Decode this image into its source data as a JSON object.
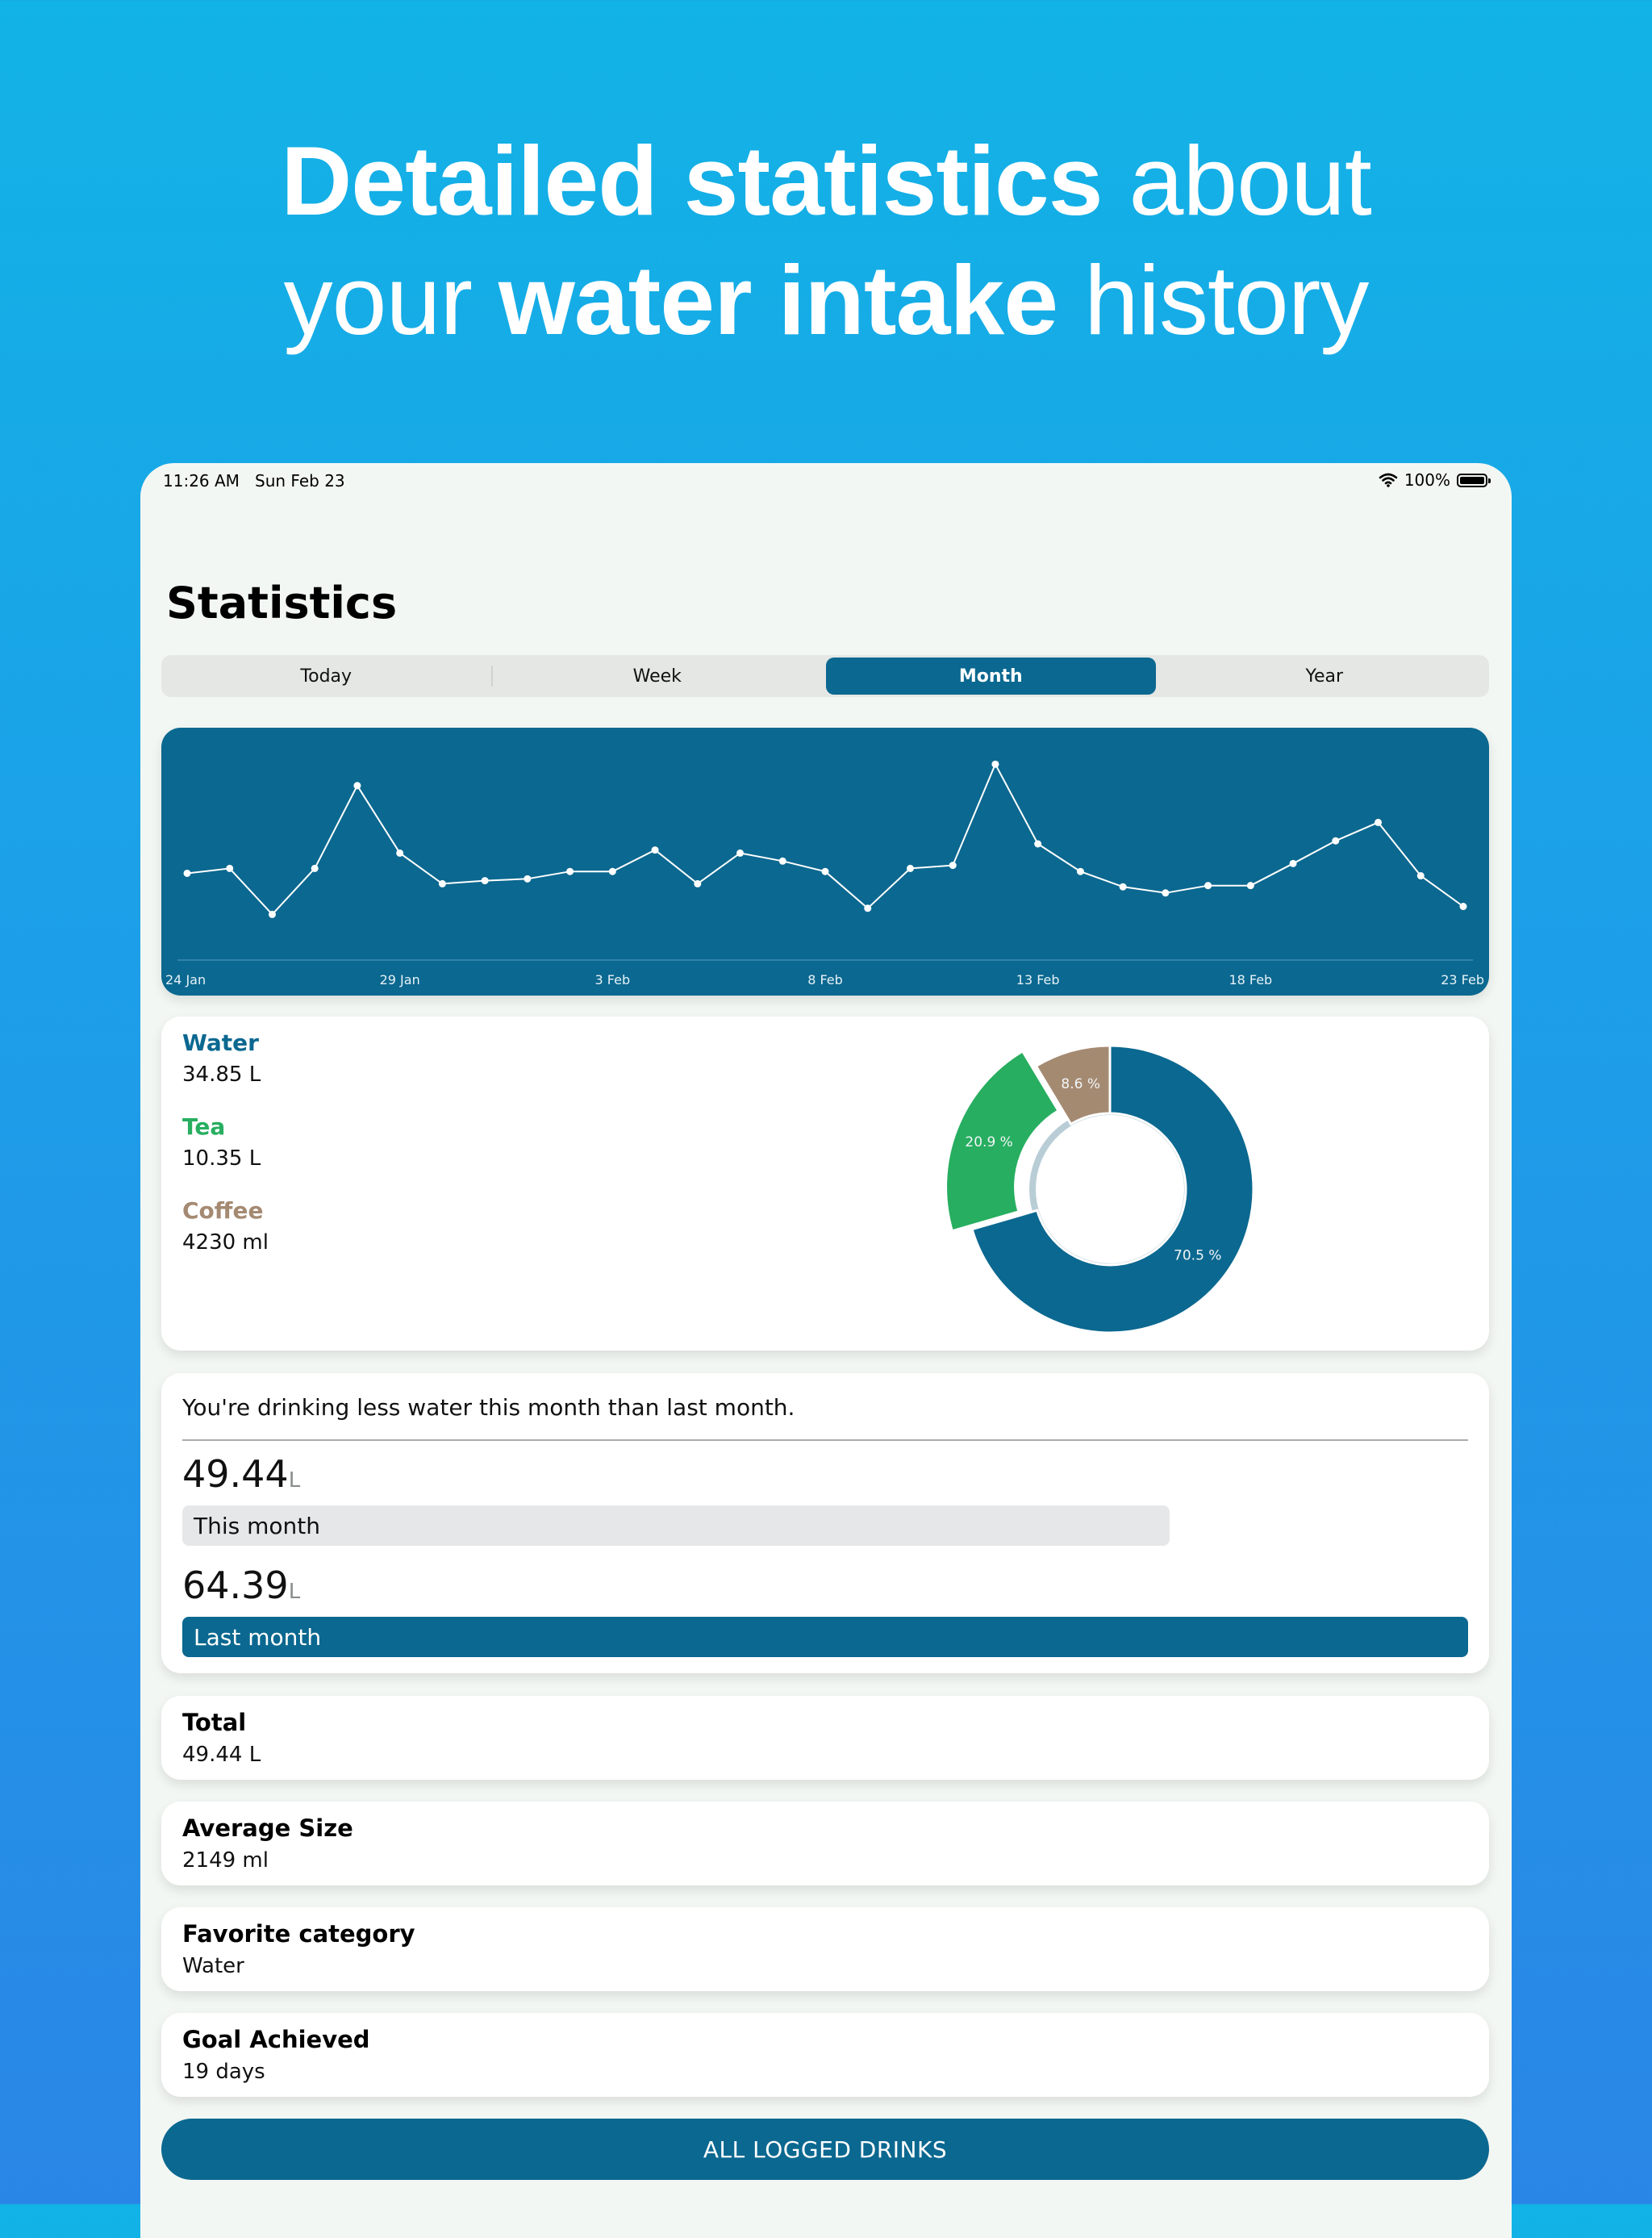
{
  "headline": {
    "line1_bold": "Detailed statistics",
    "line1_light": " about",
    "line2_light1": "your ",
    "line2_bold": "water intake",
    "line2_light2": " history"
  },
  "status_bar": {
    "time": "11:26 AM",
    "date": "Sun Feb 23",
    "battery": "100%",
    "icons": [
      "wifi-icon",
      "battery-icon"
    ]
  },
  "page_title": "Statistics",
  "tabs": [
    {
      "label": "Today",
      "active": false
    },
    {
      "label": "Week",
      "active": false
    },
    {
      "label": "Month",
      "active": true
    },
    {
      "label": "Year",
      "active": false
    }
  ],
  "chart_data": [
    {
      "type": "line",
      "x_tick_labels": [
        "24 Jan",
        "29 Jan",
        "3 Feb",
        "8 Feb",
        "13 Feb",
        "18 Feb",
        "23 Feb"
      ],
      "x": [
        "24 Jan",
        "25 Jan",
        "26 Jan",
        "27 Jan",
        "28 Jan",
        "29 Jan",
        "30 Jan",
        "31 Jan",
        "1 Feb",
        "2 Feb",
        "3 Feb",
        "4 Feb",
        "5 Feb",
        "6 Feb",
        "7 Feb",
        "8 Feb",
        "9 Feb",
        "10 Feb",
        "11 Feb",
        "12 Feb",
        "13 Feb",
        "14 Feb",
        "15 Feb",
        "16 Feb",
        "17 Feb",
        "18 Feb",
        "19 Feb",
        "20 Feb",
        "21 Feb",
        "22 Feb",
        "23 Feb"
      ],
      "values": [
        1.52,
        1.6,
        0.85,
        1.6,
        2.95,
        1.85,
        1.35,
        1.4,
        1.43,
        1.55,
        1.55,
        1.9,
        1.35,
        1.85,
        1.72,
        1.55,
        0.95,
        1.6,
        1.65,
        3.3,
        2.0,
        1.55,
        1.3,
        1.2,
        1.32,
        1.32,
        1.68,
        2.05,
        2.35,
        1.48,
        0.98
      ],
      "ylim": [
        0.5,
        3.5
      ],
      "grid": false,
      "legend": "none",
      "line_color": "#ffffff",
      "background": "#0b6890"
    },
    {
      "type": "pie",
      "variant": "donut",
      "categories": [
        "Water",
        "Tea",
        "Coffee"
      ],
      "values": [
        70.5,
        20.9,
        8.6
      ],
      "labels": [
        "70.5 %",
        "20.9 %",
        "8.6 %"
      ],
      "colors": [
        "#0b6890",
        "#27ae60",
        "#a58a72"
      ],
      "emphasized": "Tea"
    }
  ],
  "breakdown": {
    "items": [
      {
        "name": "Water",
        "amount": "34.85 L",
        "color": "#0b6890"
      },
      {
        "name": "Tea",
        "amount": "10.35 L",
        "color": "#27ae60"
      },
      {
        "name": "Coffee",
        "amount": "4230 ml",
        "color": "#a58a72"
      }
    ]
  },
  "comparison": {
    "message": "You're drinking less water this month than last month.",
    "this_month": {
      "value": "49.44",
      "unit": "L",
      "label": "This month",
      "fraction_of_max": 0.768
    },
    "last_month": {
      "value": "64.39",
      "unit": "L",
      "label": "Last month",
      "fraction_of_max": 1.0
    }
  },
  "stats": [
    {
      "label": "Total",
      "value": "49.44 L"
    },
    {
      "label": "Average Size",
      "value": "2149 ml"
    },
    {
      "label": "Favorite category",
      "value": "Water"
    },
    {
      "label": "Goal Achieved",
      "value": "19 days"
    }
  ],
  "cta_label": "ALL LOGGED DRINKS",
  "colors": {
    "accent": "#0b6890",
    "tea": "#27ae60",
    "coffee": "#a58a72",
    "background_top": "#12b3e6",
    "background_bottom": "#2a86e6"
  }
}
